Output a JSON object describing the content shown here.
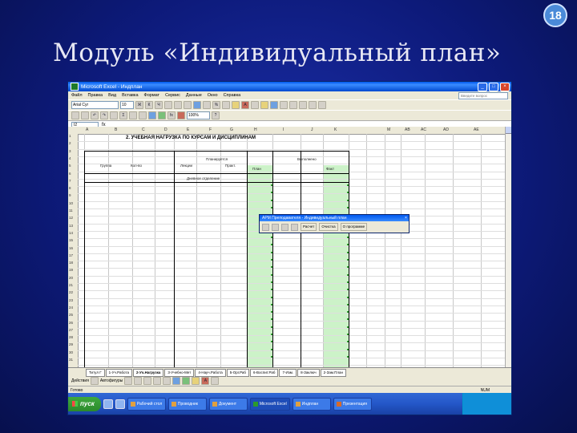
{
  "slide": {
    "number": "18",
    "title": "Модуль «Индивидуальный план»"
  },
  "window": {
    "title": "Microsoft Excel - Индплан"
  },
  "menu": {
    "items": [
      "Файл",
      "Правка",
      "Вид",
      "Вставка",
      "Формат",
      "Сервис",
      "Данные",
      "Окно",
      "Справка"
    ],
    "ask_placeholder": "Введите вопрос"
  },
  "toolbar": {
    "font": "Arial Cyr",
    "size": "10",
    "zoom": "100%"
  },
  "formula": {
    "cell": "I2"
  },
  "sheet": {
    "columns": [
      "A",
      "B",
      "C",
      "D",
      "E",
      "F",
      "G",
      "H",
      "I",
      "J",
      "K",
      "M",
      "AB",
      "AC",
      "AD",
      "AE"
    ],
    "heading": "2. УЧЕБНАЯ НАГРУЗКА ПО КУРСАМ И ДИСЦИПЛИНАМ",
    "planned_header": "Планируется",
    "done_header": "Выполнено",
    "col_labels": [
      "Группа",
      "Кол-во",
      "Лекции",
      "Практ.",
      "План",
      "Факт"
    ],
    "section": "Дневное отделение",
    "rows": [
      "1",
      "2",
      "3",
      "4",
      "5",
      "6",
      "7",
      "8",
      "9",
      "10",
      "11",
      "12",
      "13",
      "14",
      "15",
      "16",
      "17",
      "18",
      "19",
      "20",
      "21",
      "22",
      "23",
      "24",
      "25",
      "26",
      "27",
      "28",
      "29",
      "30",
      "31"
    ]
  },
  "sheet_tabs": [
    "Титул Г",
    "1-Уч.Работа",
    "2-Уч.Нагрузка",
    "3-Учебно-Мет",
    "4-Науч.Работа",
    "5-Орг.Раб",
    "6-Воспит.Раб",
    "7-Изм.",
    "8-Заключ",
    "2-Зам.План"
  ],
  "drawing_bar": {
    "actions_label": "Действия",
    "autoshapes_label": "Автофигуры"
  },
  "status": {
    "ready": "Готово",
    "num": "NUM"
  },
  "floating_toolbar": {
    "title": "АРМ Преподавателя - Индивидуальный план",
    "calc_label": "Расчет",
    "clear_label": "Очистка",
    "about_label": "О программе"
  },
  "taskbar": {
    "start_label": "пуск",
    "tasks": [
      "Рабочий стол",
      "Проводник",
      "Документ",
      "Microsoft Excel",
      "Индплан",
      "Презентация"
    ]
  }
}
